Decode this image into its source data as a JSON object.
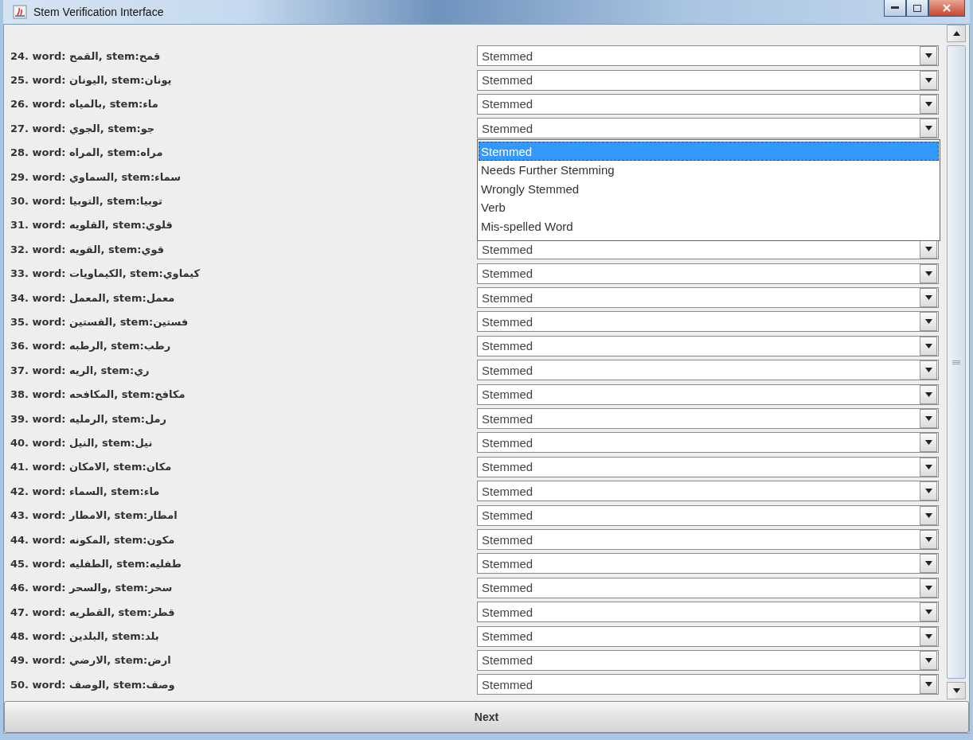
{
  "window": {
    "title": "Stem Verification Interface"
  },
  "rows": [
    {
      "label": "24. word: القمح, stem:قمح",
      "value": "Stemmed"
    },
    {
      "label": "25. word: اليونان, stem:يونان",
      "value": "Stemmed"
    },
    {
      "label": "26. word: بالمياه, stem:ماء",
      "value": "Stemmed"
    },
    {
      "label": "27. word: الجوي, stem:جو",
      "value": "Stemmed",
      "options": [
        {
          "label": "Stemmed",
          "selected": true
        },
        {
          "label": "Needs Further Stemming",
          "selected": false
        },
        {
          "label": "Wrongly Stemmed",
          "selected": false
        },
        {
          "label": "Verb",
          "selected": false
        },
        {
          "label": "Mis-spelled Word",
          "selected": false
        }
      ]
    },
    {
      "label": "28. word: المراه, stem:مراه"
    },
    {
      "label": "29. word: السماوي, stem:سماء"
    },
    {
      "label": "30. word: التوبيا, stem:توبيا"
    },
    {
      "label": "31. word: القلويه, stem:قلوي"
    },
    {
      "label": "32. word: القويه, stem:قوي",
      "value": "Stemmed"
    },
    {
      "label": "33. word: الكيماويات, stem:كيماوي",
      "value": "Stemmed"
    },
    {
      "label": "34. word: المعمل, stem:معمل",
      "value": "Stemmed"
    },
    {
      "label": "35. word: الفستين, stem:فستين",
      "value": "Stemmed"
    },
    {
      "label": "36. word: الرطبه, stem:رطب",
      "value": "Stemmed"
    },
    {
      "label": "37. word: الريه, stem:ري",
      "value": "Stemmed"
    },
    {
      "label": "38. word: المكافحه, stem:مكافح",
      "value": "Stemmed"
    },
    {
      "label": "39. word: الرمليه, stem:رمل",
      "value": "Stemmed"
    },
    {
      "label": "40. word: النيل, stem:نيل",
      "value": "Stemmed"
    },
    {
      "label": "41. word: الامكان, stem:مكان",
      "value": "Stemmed"
    },
    {
      "label": "42. word: السماء, stem:ماء",
      "value": "Stemmed"
    },
    {
      "label": "43. word: الامطار, stem:امطار",
      "value": "Stemmed"
    },
    {
      "label": "44. word: المكونه, stem:مكون",
      "value": "Stemmed"
    },
    {
      "label": "45. word: الطفليه, stem:طفليه",
      "value": "Stemmed"
    },
    {
      "label": "46. word: والسحر, stem:سحر",
      "value": "Stemmed"
    },
    {
      "label": "47. word: القطريه, stem:قطر",
      "value": "Stemmed"
    },
    {
      "label": "48. word: البلدين, stem:بلد",
      "value": "Stemmed"
    },
    {
      "label": "49. word: الارضي, stem:ارض",
      "value": "Stemmed"
    },
    {
      "label": "50. word: الوصف, stem:وصف",
      "value": "Stemmed"
    }
  ],
  "next_button": "Next"
}
